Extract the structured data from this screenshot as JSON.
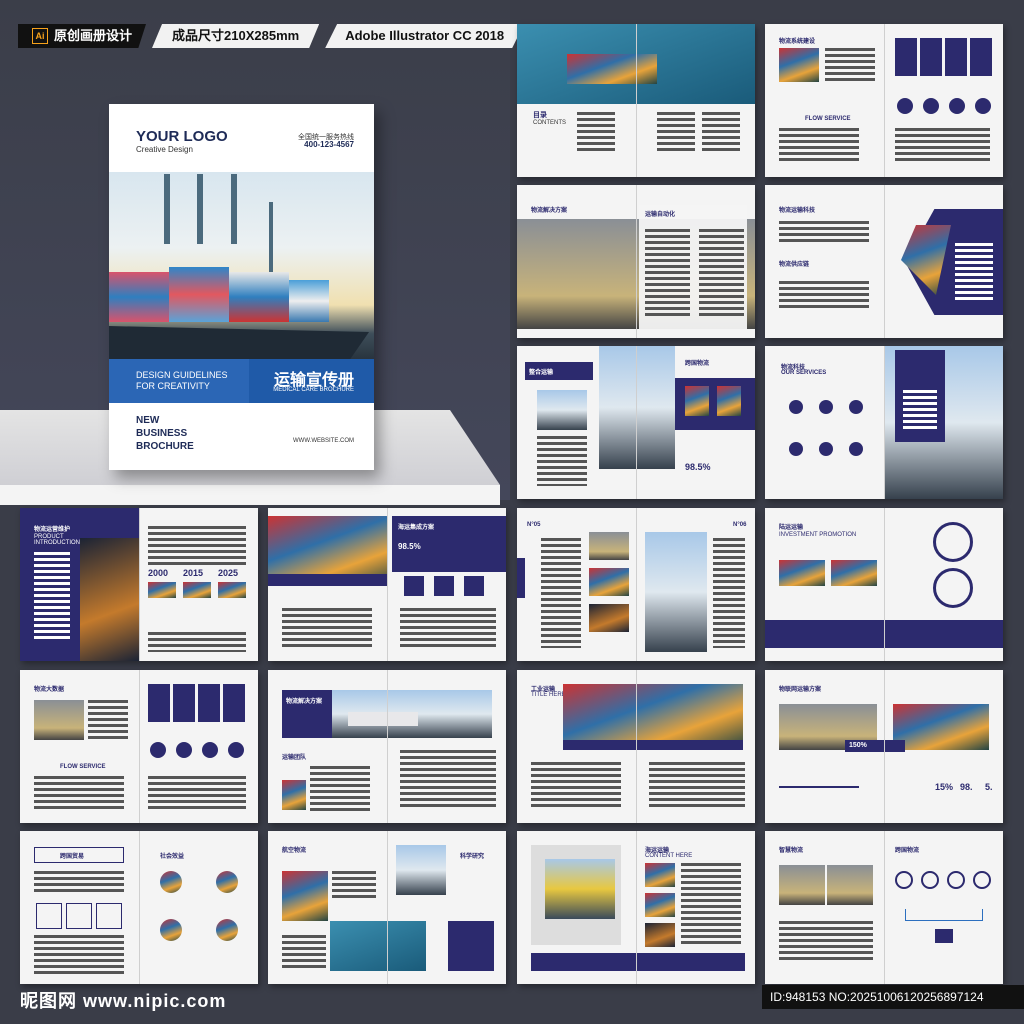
{
  "tags": {
    "software_short": "Ai",
    "design_label": "原创画册设计",
    "size_label": "成品尺寸210X285mm",
    "app_label": "Adobe Illustrator CC 2018"
  },
  "cover": {
    "logo": "YOUR LOGO",
    "logo_sub": "Creative Design",
    "hotline": "全国统一服务热线",
    "phone": "400-123-4567",
    "guide_line1": "DESIGN GUIDELINES",
    "guide_line2": "FOR CREATIVITY",
    "title_cn": "运输宣传册",
    "title_en": "MEDICAL CARE BROCHURE",
    "nbb_line1": "NEW",
    "nbb_line2": "BUSINESS",
    "nbb_line3": "BROCHURE",
    "website": "WWW.WEBSITE.COM"
  },
  "spreads": [
    {
      "t1": "目录",
      "t2": "CONTENTS"
    },
    {
      "t1": "物流系统建设",
      "t2": "FLOW SERVICE"
    },
    {
      "t1": "物流解决方案",
      "t2": "运输自动化"
    },
    {
      "t1": "物流运输科技",
      "t2": "物流供应链"
    },
    {
      "t1": "整合运输",
      "t2": "跨国物流",
      "num": "98.5%"
    },
    {
      "t1": "物流科技",
      "t2": "OUR SERVICES"
    },
    {
      "t1": "物流运营维护",
      "t2": "PRODUCT INTRODUCTION",
      "y1": "2000",
      "y2": "2015",
      "y3": "2025"
    },
    {
      "t1": "海运集成方案",
      "t2": "98.5%"
    },
    {
      "t1": "N°05",
      "t2": "N°06"
    },
    {
      "t1": "陆运运输",
      "t2": "INVESTMENT PROMOTION"
    },
    {
      "t1": "物流大数据",
      "t2": "FLOW SERVICE"
    },
    {
      "t1": "物流解决方案",
      "t2": "运输团队"
    },
    {
      "t1": "工业运输",
      "t2": "TITLE HERE"
    },
    {
      "t1": "物联网运输方案",
      "t2": "150%",
      "n1": "15%",
      "n2": "98.",
      "n3": "5."
    },
    {
      "t1": "跨国贸易",
      "t2": "社会效益"
    },
    {
      "t1": "航空物流",
      "t2": "科学研究"
    },
    {
      "t1": "海运运输",
      "t2": "CONTENT HERE"
    },
    {
      "t1": "智慧物流",
      "t2": "跨国物流"
    }
  ],
  "footer": {
    "site_logo": "昵图网 www.nipic.com",
    "id_text": "ID:948153 NO:20251006120256897124"
  }
}
